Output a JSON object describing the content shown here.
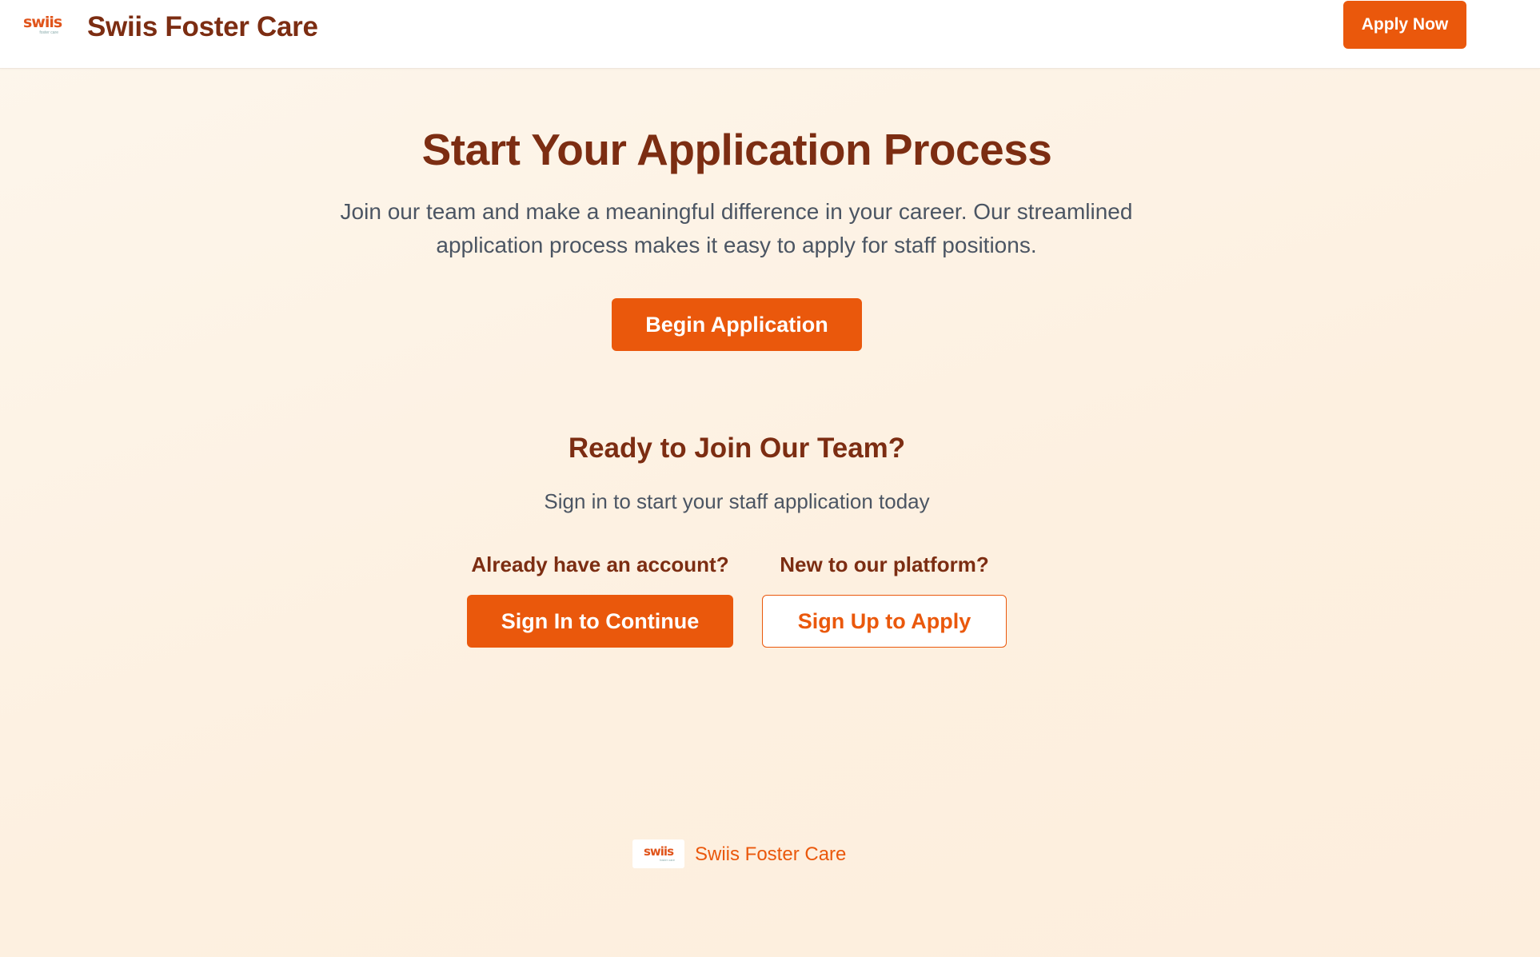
{
  "header": {
    "logo_text": "swiis",
    "logo_tagline": "foster care",
    "title": "Swiis Foster Care",
    "apply_now_label": "Apply Now"
  },
  "hero": {
    "title": "Start Your Application Process",
    "subtitle": "Join our team and make a meaningful difference in your career. Our streamlined application process makes it easy to apply for staff positions.",
    "begin_label": "Begin Application"
  },
  "join": {
    "title": "Ready to Join Our Team?",
    "subtitle": "Sign in to start your staff application today",
    "existing_label": "Already have an account?",
    "signin_label": "Sign In to Continue",
    "new_label": "New to our platform?",
    "signup_label": "Sign Up to Apply"
  },
  "footer": {
    "logo_text": "swiis",
    "logo_tagline": "foster care",
    "brand": "Swiis Foster Care"
  },
  "colors": {
    "primary": "#ea580c",
    "heading": "#7c2d12",
    "body_text": "#4b5563",
    "background": "#fdf4e8"
  }
}
